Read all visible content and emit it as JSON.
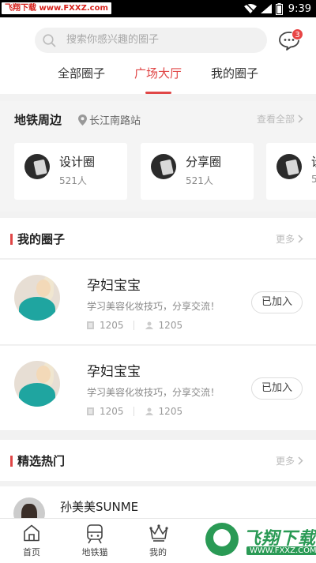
{
  "status_bar": {
    "watermark": "飞翔下载 www.FXXZ.com",
    "time": "9:39"
  },
  "header": {
    "search_placeholder": "搜索你感兴趣的圈子",
    "message_badge": "3",
    "tabs": [
      {
        "label": "全部圈子",
        "active": false
      },
      {
        "label": "广场大厅",
        "active": true
      },
      {
        "label": "我的圈子",
        "active": false
      }
    ]
  },
  "metro": {
    "title": "地铁周边",
    "location": "长江南路站",
    "more": "查看全部",
    "cards": [
      {
        "name": "设计圈",
        "count": "521人"
      },
      {
        "name": "分享圈",
        "count": "521人"
      },
      {
        "name": "设",
        "count": "5"
      }
    ]
  },
  "my_circles": {
    "title": "我的圈子",
    "more": "更多",
    "items": [
      {
        "name": "孕妇宝宝",
        "desc": "学习美容化妆技巧，分享交流！",
        "posts": "1205",
        "members": "1205",
        "button": "已加入"
      },
      {
        "name": "孕妇宝宝",
        "desc": "学习美容化妆技巧，分享交流！",
        "posts": "1205",
        "members": "1205",
        "button": "已加入"
      }
    ]
  },
  "featured": {
    "title": "精选热门",
    "more": "更多",
    "first_user": "孙美美SUNME"
  },
  "bottom_nav": {
    "items": [
      {
        "label": "首页",
        "icon": "home-icon"
      },
      {
        "label": "地铁猫",
        "icon": "subway-icon"
      },
      {
        "label": "我的",
        "icon": "crown-icon"
      }
    ],
    "brand_logo_text": "飞翔下载",
    "brand_logo_sub": "WWW.FXXZ.COM"
  },
  "colors": {
    "accent": "#e04646",
    "brand_green": "#2a9a55"
  }
}
